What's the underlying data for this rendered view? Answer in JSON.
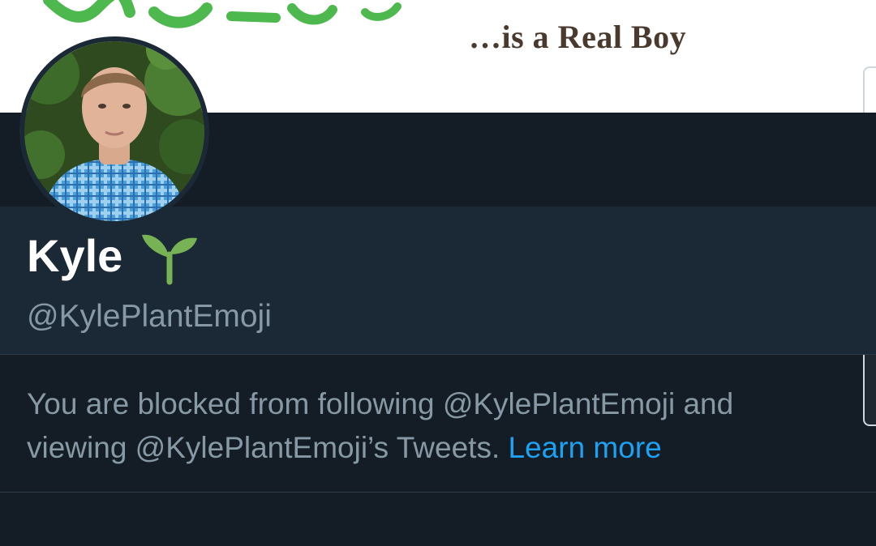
{
  "banner": {
    "tagline": "…is a Real Boy"
  },
  "profile": {
    "name": "Kyle",
    "name_emoji": "seedling-icon",
    "handle": "@KylePlantEmoji"
  },
  "blocked_notice": {
    "line1": "You are blocked from following @KylePlantEmoji and",
    "line2": "viewing @KylePlantEmoji’s Tweets.",
    "learn_more": "Learn more"
  },
  "colors": {
    "background": "#141d26",
    "card": "#1b2836",
    "secondary_text": "#8899a6",
    "link": "#1da1f2",
    "seedling": "#77b255"
  }
}
